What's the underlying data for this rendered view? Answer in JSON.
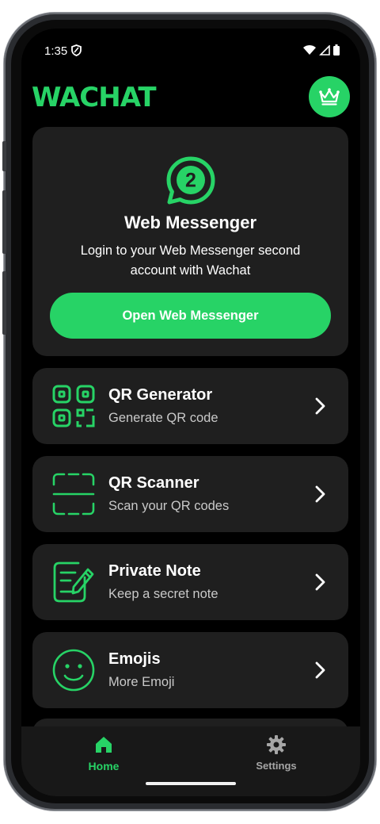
{
  "status": {
    "time": "1:35"
  },
  "header": {
    "brand": "WACHAT"
  },
  "hero": {
    "badge_number": "2",
    "title": "Web Messenger",
    "description": "Login to your Web Messenger second account with Wachat",
    "button_label": "Open Web Messenger"
  },
  "features": [
    {
      "title": "QR Generator",
      "subtitle": "Generate QR code",
      "icon": "qr-generator-icon"
    },
    {
      "title": "QR Scanner",
      "subtitle": "Scan your QR codes",
      "icon": "qr-scanner-icon"
    },
    {
      "title": "Private Note",
      "subtitle": "Keep a secret note",
      "icon": "private-note-icon"
    },
    {
      "title": "Emojis",
      "subtitle": "More Emoji",
      "icon": "emoji-icon"
    }
  ],
  "nav": {
    "home": "Home",
    "settings": "Settings"
  },
  "colors": {
    "accent": "#27d366",
    "card": "#1f1f1f",
    "background": "#000000"
  }
}
